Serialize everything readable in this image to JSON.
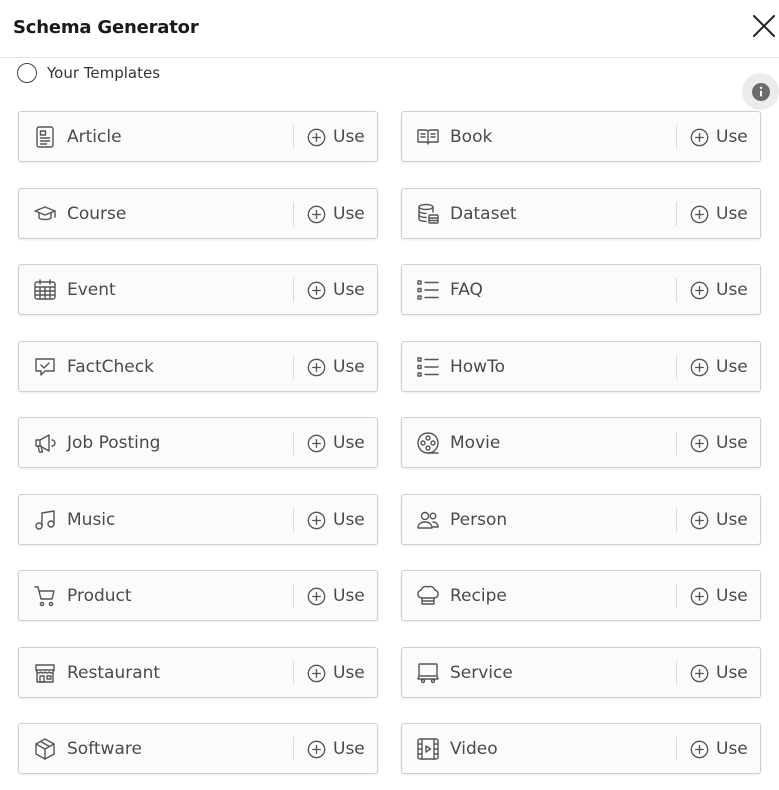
{
  "header": {
    "title": "Schema Generator"
  },
  "templates": {
    "label": "Your Templates"
  },
  "use_label": "Use",
  "items": [
    {
      "label": "Article",
      "icon": "article-icon"
    },
    {
      "label": "Book",
      "icon": "book-icon"
    },
    {
      "label": "Course",
      "icon": "graduation-cap-icon"
    },
    {
      "label": "Dataset",
      "icon": "database-icon"
    },
    {
      "label": "Event",
      "icon": "calendar-icon"
    },
    {
      "label": "FAQ",
      "icon": "list-icon"
    },
    {
      "label": "FactCheck",
      "icon": "message-check-icon"
    },
    {
      "label": "HowTo",
      "icon": "list-icon"
    },
    {
      "label": "Job Posting",
      "icon": "megaphone-icon"
    },
    {
      "label": "Movie",
      "icon": "film-reel-icon"
    },
    {
      "label": "Music",
      "icon": "music-note-icon"
    },
    {
      "label": "Person",
      "icon": "people-icon"
    },
    {
      "label": "Product",
      "icon": "shopping-cart-icon"
    },
    {
      "label": "Recipe",
      "icon": "chef-hat-icon"
    },
    {
      "label": "Restaurant",
      "icon": "storefront-icon"
    },
    {
      "label": "Service",
      "icon": "service-icon"
    },
    {
      "label": "Software",
      "icon": "box-icon"
    },
    {
      "label": "Video",
      "icon": "video-icon"
    }
  ]
}
